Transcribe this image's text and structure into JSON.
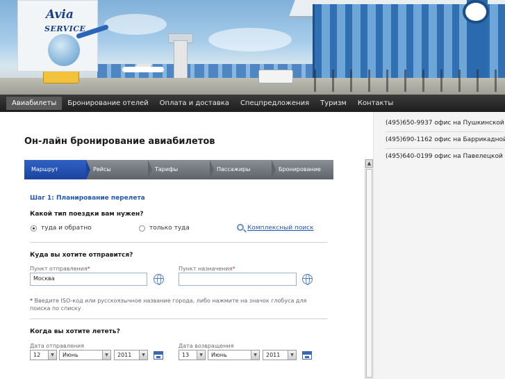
{
  "logo": {
    "line1": "Avia",
    "line2": "SERVICE"
  },
  "nav": {
    "items": [
      {
        "label": "Авиабилеты",
        "active": true
      },
      {
        "label": "Бронирование отелей",
        "active": false
      },
      {
        "label": "Оплата и доставка",
        "active": false
      },
      {
        "label": "Спецпредложения",
        "active": false
      },
      {
        "label": "Туризм",
        "active": false
      },
      {
        "label": "Контакты",
        "active": false
      }
    ]
  },
  "sidebar": {
    "offices": [
      "(495)650-9937 офис на Пушкинской",
      "(495)690-1162 офис на Баррикадной",
      "(495)640-0199 офис на Павелецкой"
    ]
  },
  "main": {
    "title": "Он-лайн бронирование авиабилетов",
    "steps": [
      "Маршрут",
      "Рейсы",
      "Тарифы",
      "Пассажиры",
      "Бронирование"
    ],
    "active_step": "Маршрут",
    "step_heading": "Шаг 1: Планирование перелета",
    "trip_question": "Какой тип поездки вам нужен?",
    "trip_options": [
      {
        "label": "туда и обратно",
        "checked": true
      },
      {
        "label": "только туда",
        "checked": false
      }
    ],
    "complex_search": "Комплексный поиск",
    "where_question": "Куда вы хотите отправится?",
    "from_label": "Пункт отправления",
    "from_value": "Москва",
    "to_label": "Пункт назначения",
    "to_value": "",
    "required_mark": "*",
    "hint": "Введите ISO-код или русскоязычное название города, либо нажмите на значок глобуса для поиска по списку",
    "hint_mark": "*",
    "when_question": "Когда вы хотите лететь?",
    "depart_label": "Дата отправления",
    "return_label": "Дата возвращения",
    "depart": {
      "day": "12",
      "month": "Июнь",
      "year": "2011"
    },
    "return": {
      "day": "13",
      "month": "Июнь",
      "year": "2011"
    }
  },
  "scrollbar": {
    "up_arrow": "▲"
  }
}
